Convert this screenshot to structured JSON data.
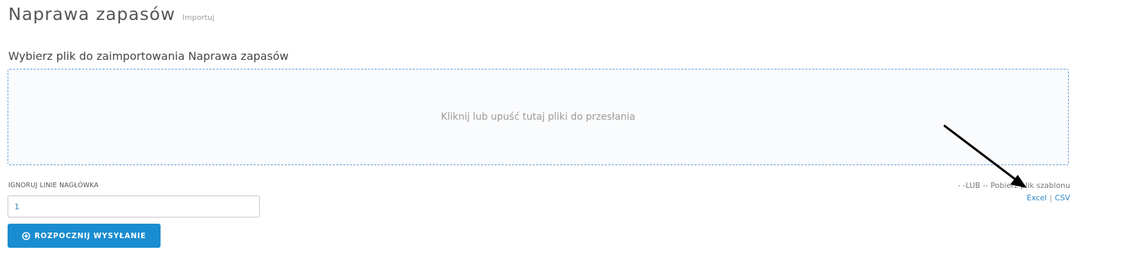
{
  "header": {
    "title": "Naprawa zapasów",
    "subtitle": "Importuj"
  },
  "section": {
    "title": "Wybierz plik do zaimportowania Naprawa zapasów"
  },
  "dropzone": {
    "text": "Kliknij lub upuść tutaj pliki do przesłania"
  },
  "ignore_header": {
    "label": "IGNORUJ LINIE NAGŁÓWKA",
    "value": "1"
  },
  "upload_button": {
    "icon": "plus-circle-icon",
    "label": "ROZPOCZNIJ WYSYŁANIE"
  },
  "template": {
    "text": "- -LUB -- Pobierz plik szablonu",
    "excel_label": "Excel",
    "separator": "|",
    "csv_label": "CSV"
  },
  "annotation": {
    "icon": "arrow-icon",
    "color": "#000000"
  },
  "colors": {
    "accent": "#1a8dd1",
    "link": "#2b87c6",
    "dropzone_border": "#5b9bd5"
  }
}
